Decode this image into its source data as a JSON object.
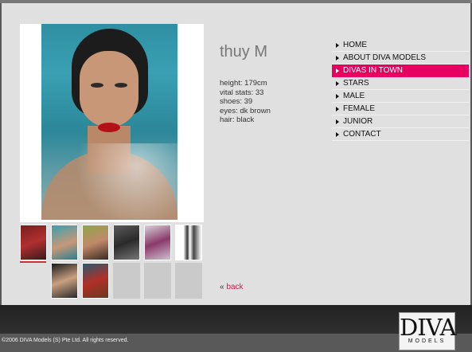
{
  "model": {
    "name": "thuy M",
    "stats": [
      "height: 179cm",
      "vital stats: 33",
      "shoes: 39",
      "eyes: dk brown",
      "hair: black"
    ]
  },
  "back": {
    "prefix": "«",
    "label": "back"
  },
  "nav": {
    "items": [
      {
        "label": "HOME"
      },
      {
        "label": "ABOUT DIVA MODELS"
      },
      {
        "label": "DIVAS IN TOWN",
        "active": true
      },
      {
        "label": "STARS"
      },
      {
        "label": "MALE"
      },
      {
        "label": "FEMALE"
      },
      {
        "label": "JUNIOR"
      },
      {
        "label": "CONTACT"
      }
    ]
  },
  "logo": {
    "big": "DIVA",
    "small": "MODELS"
  },
  "footer": {
    "copyright": "©2006 DIVA Models (S) Pte Ltd. All rights reserved."
  },
  "colors": {
    "accent": "#e7005f",
    "link": "#d11a4c",
    "panel": "#e0e0e0"
  }
}
